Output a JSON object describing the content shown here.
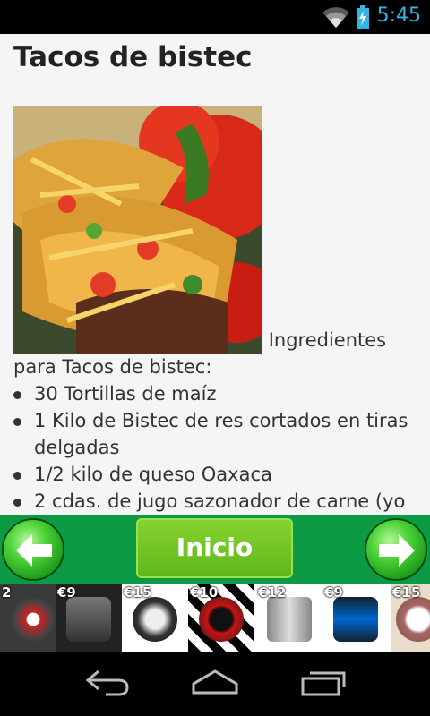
{
  "status_bar": {
    "time": "5:45",
    "icons": [
      "wifi-icon",
      "battery-icon"
    ],
    "accent_color": "#33b5e5"
  },
  "recipe": {
    "title": "Tacos de bistec",
    "image": "tacos-photo",
    "intro": "Ingredientes para Tacos de bistec:",
    "ingredients": [
      "30 Tortillas de maíz",
      "1 Kilo de Bistec de res cortados en tiras delgadas",
      "1/2 kilo de queso Oaxaca",
      "2 cdas. de jugo sazonador de carne (yo"
    ]
  },
  "navigation": {
    "back_icon": "arrow-left-icon",
    "home_label": "Inicio",
    "forward_icon": "arrow-right-icon",
    "bar_color": "#0c9a44"
  },
  "ads": [
    {
      "price": "2",
      "icon": "watch-icon"
    },
    {
      "price": "€9",
      "icon": "watch-icon"
    },
    {
      "price": "€15",
      "icon": "watch-icon"
    },
    {
      "price": "€10",
      "icon": "watch-icon"
    },
    {
      "price": "€12",
      "icon": "watch-icon"
    },
    {
      "price": "€9",
      "icon": "watch-icon"
    },
    {
      "price": "€15",
      "icon": "watch-icon"
    }
  ],
  "system_nav": [
    "back-icon",
    "home-icon",
    "recent-apps-icon"
  ]
}
